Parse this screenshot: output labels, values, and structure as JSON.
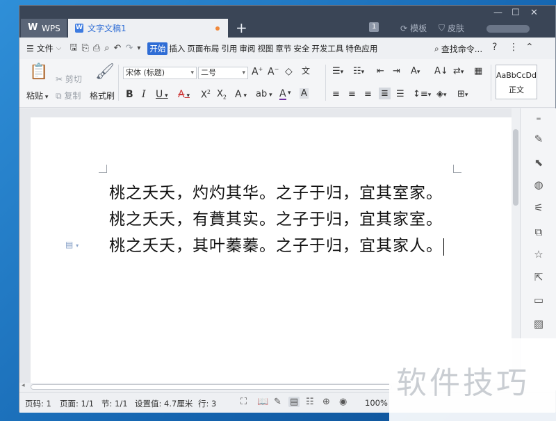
{
  "title_bar": {
    "app_tab": "WPS",
    "doc_tab": "文字文稿1",
    "new_tab_glyph": "+",
    "badge_count": "1",
    "template_label": "模板",
    "skin_label": "皮肤"
  },
  "menu": {
    "file_label": "文件",
    "tabs": [
      "开始",
      "插入",
      "页面布局",
      "引用",
      "审阅",
      "视图",
      "章节",
      "安全",
      "开发工具",
      "特色应用"
    ],
    "active_tab": "开始",
    "search_label": "查找命令..."
  },
  "ribbon": {
    "paste_label": "粘贴",
    "cut_label": "剪切",
    "copy_label": "复制",
    "format_painter_label": "格式刷",
    "font_name": "宋体 (标题)",
    "font_size": "二号",
    "style_preview": "AaBbCcDd",
    "style_name": "正文"
  },
  "document": {
    "lines": [
      "桃之夭夭，灼灼其华。之子于归，宜其室家。",
      "桃之夭夭，有蕡其实。之子于归，宜其家室。",
      "桃之夭夭，其叶蓁蓁。之子于归，宜其家人。"
    ]
  },
  "status": {
    "page_no": "页码: 1",
    "pages": "页面: 1/1",
    "section": "节: 1/1",
    "setting": "设置值: 4.7厘米",
    "row": "行: 3",
    "zoom": "100%"
  },
  "watermark": "软件技巧"
}
